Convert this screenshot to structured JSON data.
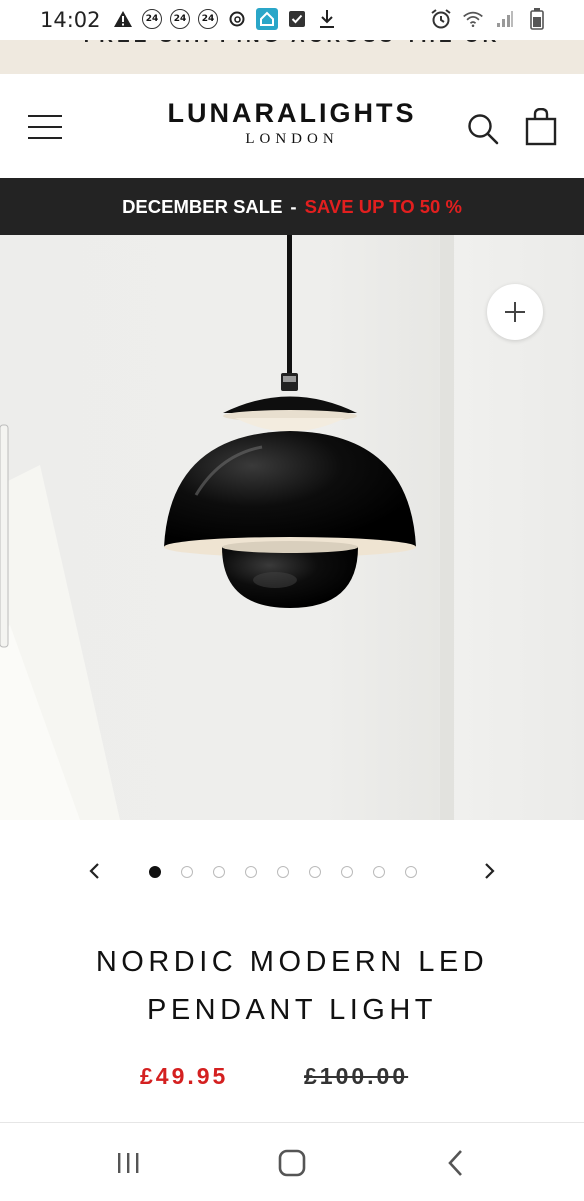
{
  "status_bar": {
    "time": "14:02",
    "badge_numbers": [
      "24",
      "24",
      "24"
    ],
    "icons": [
      "warning-icon",
      "threads-icon",
      "home-app-icon",
      "checkbox-icon",
      "download-icon",
      "alarm-icon",
      "wifi-icon",
      "signal-icon",
      "battery-icon"
    ]
  },
  "shipping_banner": {
    "text": "FREE SHIPPING ACROSS THE UK"
  },
  "header": {
    "brand": "LUNARALIGHTS",
    "brand_sub": "LONDON",
    "icons": [
      "menu-icon",
      "search-icon",
      "shopping-bag-icon"
    ]
  },
  "sale_banner": {
    "label": "DECEMBER SALE",
    "separator": "-",
    "highlight": "SAVE UP TO 50 %",
    "highlight_color": "#e21f1f"
  },
  "gallery": {
    "image_count": 9,
    "active_index": 0,
    "icons": [
      "zoom-plus-icon",
      "chevron-left-icon",
      "chevron-right-icon"
    ]
  },
  "product": {
    "title_line1": "NORDIC MODERN LED",
    "title_line2": "PENDANT LIGHT",
    "sale_price": "£49.95",
    "original_price": "£100.00",
    "sale_color": "#d42020"
  },
  "system_nav": {
    "icons": [
      "recent-apps-icon",
      "home-icon",
      "back-icon"
    ]
  }
}
